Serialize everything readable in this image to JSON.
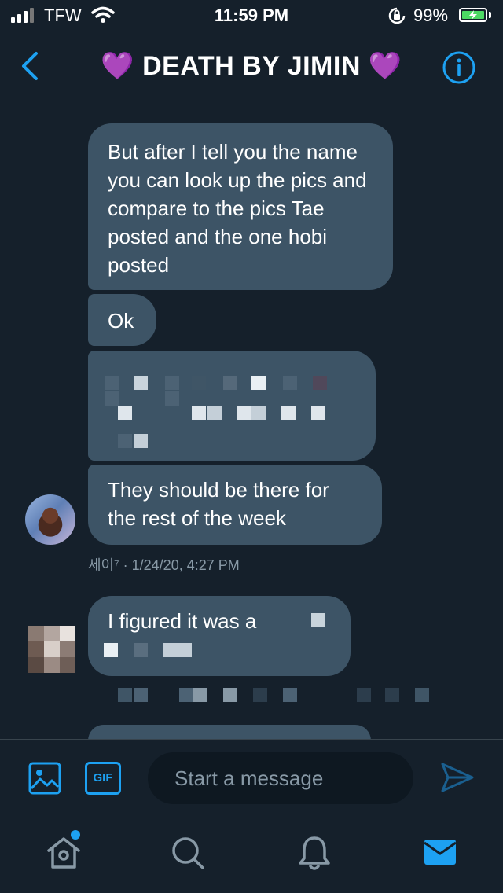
{
  "status_bar": {
    "carrier": "TFW",
    "time": "11:59 PM",
    "battery_pct": "99%",
    "battery_color": "#4cd964"
  },
  "header": {
    "title": "💜 DEATH BY JIMIN 💜",
    "back_icon": "chevron-left-icon",
    "info_icon": "info-icon",
    "accent": "#1da1f2"
  },
  "messages": [
    {
      "text": "But after I tell you the name you can look up the pics and compare to the pics Tae posted and the one hobi posted"
    },
    {
      "text": "Ok"
    },
    {
      "text": ""
    },
    {
      "text": "They should be there for the rest of the week"
    },
    {
      "text": "I figured it was a"
    }
  ],
  "meta": {
    "sender": "세이⁷",
    "timestamp": "· 1/24/20, 4:27 PM"
  },
  "composer": {
    "placeholder": "Start a message",
    "gif_label": "GIF",
    "image_icon": "image-icon",
    "send_icon": "send-icon"
  },
  "tabs": [
    {
      "icon": "home-icon",
      "has_badge": true
    },
    {
      "icon": "search-icon"
    },
    {
      "icon": "bell-icon"
    },
    {
      "icon": "mail-icon",
      "active": true
    }
  ],
  "colors": {
    "background": "#15202b",
    "bubble": "#3d5466",
    "muted": "#8899a6",
    "divider": "#38444d"
  }
}
